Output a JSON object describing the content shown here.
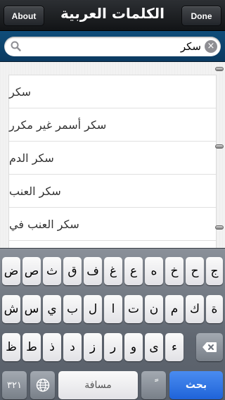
{
  "navbar": {
    "title": "الكلمات العربية",
    "about_label": "About",
    "done_label": "Done"
  },
  "search": {
    "value": "سكر",
    "placeholder": ""
  },
  "results": [
    "سكر",
    "سكر أسمر غير مكرر",
    "سكر الدم",
    "سكر العنب",
    "سكر العنب في"
  ],
  "keyboard": {
    "row1": [
      "ض",
      "ص",
      "ث",
      "ق",
      "ف",
      "غ",
      "ع",
      "ه",
      "خ",
      "ح",
      "ج"
    ],
    "row2": [
      "ش",
      "س",
      "ي",
      "ب",
      "ل",
      "ا",
      "ت",
      "ن",
      "م",
      "ك",
      "ة"
    ],
    "row3": [
      "ظ",
      "ط",
      "ذ",
      "د",
      "ز",
      "ر",
      "و",
      "ى",
      "ء"
    ],
    "numbers_label": "٣٢١",
    "space_label": "مسافة",
    "diacritic_label": "ً",
    "search_label": "بحث",
    "globe_icon": "globe-icon",
    "backspace_icon": "backspace-icon"
  },
  "colors": {
    "searchbar_blue": "#0f4d7a",
    "search_key_blue": "#1f63d8"
  }
}
